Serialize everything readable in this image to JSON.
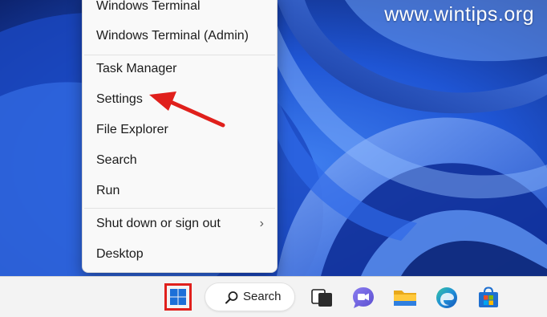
{
  "watermark": {
    "text": "www.wintips.org"
  },
  "context_menu": {
    "items": [
      {
        "label": "Windows Terminal"
      },
      {
        "label": "Windows Terminal (Admin)"
      },
      {
        "label": "Task Manager"
      },
      {
        "label": "Settings"
      },
      {
        "label": "File Explorer"
      },
      {
        "label": "Search"
      },
      {
        "label": "Run"
      },
      {
        "label": "Shut down or sign out",
        "submenu_icon": "chevron-right-icon"
      },
      {
        "label": "Desktop"
      }
    ],
    "submenu_glyph": "›"
  },
  "annotation": {
    "arrow_color": "#e0201c",
    "points_to": "Settings"
  },
  "taskbar": {
    "start_highlight_color": "#e0201c",
    "search_label": "Search",
    "apps": [
      {
        "icon": "windows-start-icon"
      },
      {
        "icon": "search-icon"
      },
      {
        "icon": "task-view-icon"
      },
      {
        "icon": "chat-icon"
      },
      {
        "icon": "file-explorer-icon"
      },
      {
        "icon": "edge-browser-icon"
      },
      {
        "icon": "microsoft-store-icon"
      }
    ]
  }
}
